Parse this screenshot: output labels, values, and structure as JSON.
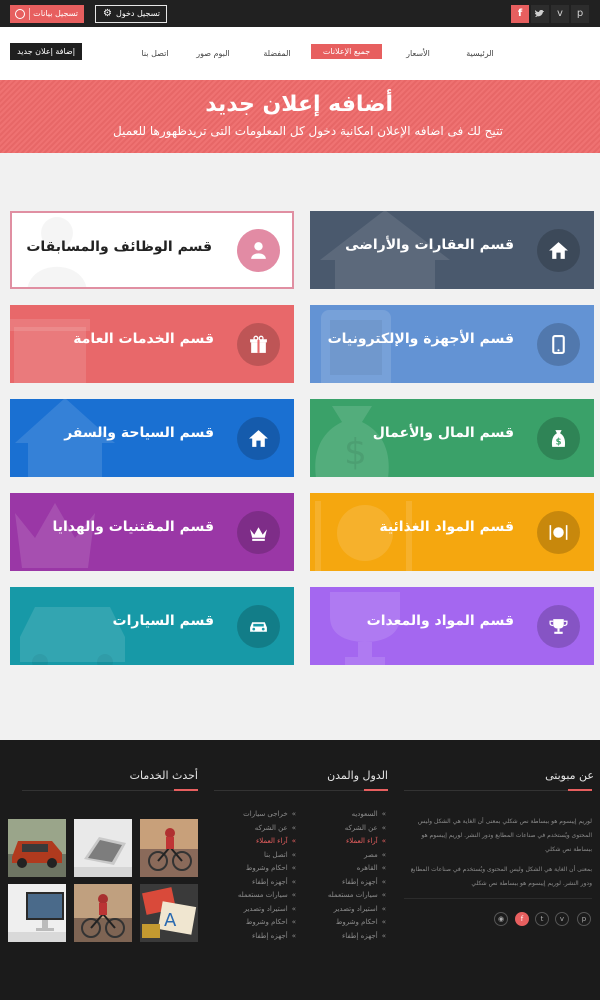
{
  "topbar": {
    "social": [
      "p",
      "v",
      "twitter",
      "f"
    ],
    "login_label": "تسجيل دخول",
    "register_label": "تسجيل بيانات"
  },
  "nav": {
    "items": [
      {
        "label": "الرئيسية",
        "active": false
      },
      {
        "label": "الأسعار",
        "active": false
      },
      {
        "label": "جميع الإعلانات",
        "active": true
      },
      {
        "label": "المفضلة",
        "active": false
      },
      {
        "label": "البوم صور",
        "active": false
      },
      {
        "label": "اتصل بنا",
        "active": false
      }
    ],
    "add_ad_label": "إضافة إعلان جديد"
  },
  "hero": {
    "title": "أضافه إعلان جديد",
    "subtitle": "تتيح لك فى اضافه الإعلان امكانية دخول كل المعلومات التى تريدظهورها للعميل"
  },
  "categories": [
    {
      "label": "قسم العقارات والأراضى",
      "icon": "home-icon",
      "color": "#4a596d"
    },
    {
      "label": "قسم الوظائف والمسابقات",
      "icon": "user-icon",
      "color": "#ffffff"
    },
    {
      "label": "قسم الأجهزة والإلكترونيات",
      "icon": "tablet-icon",
      "color": "#6393d4"
    },
    {
      "label": "قسم الخدمات العامة",
      "icon": "gift-icon",
      "color": "#e8686a"
    },
    {
      "label": "قسم المال والأعمال",
      "icon": "money-bag-icon",
      "color": "#3aa169"
    },
    {
      "label": "قسم السياحة والسفر",
      "icon": "home-icon",
      "color": "#1a70d2"
    },
    {
      "label": "قسم المواد الغذائية",
      "icon": "food-icon",
      "color": "#f5a70f"
    },
    {
      "label": "قسم المقتنيات والهدايا",
      "icon": "crown-icon",
      "color": "#9a37a6"
    },
    {
      "label": "قسم المواد والمعدات",
      "icon": "trophy-icon",
      "color": "#a467f0"
    },
    {
      "label": "قسم السيارات",
      "icon": "car-icon",
      "color": "#1799a7"
    }
  ],
  "footer": {
    "about_title": "عن مبوبتى",
    "about_text_1": "لوريم إيبسوم هو ببساطة نص شكلي بمعنى أن الغاية هي الشكل وليس المحتوى ويُستخدم في صناعات المطابع ودور النشر. لوريم إيبسوم هو ببساطة نص شكلي",
    "about_text_2": "بمعنى أن الغاية هي الشكل وليس المحتوى ويُستخدم في صناعات المطابع ودور النشر. لوريم إيبسوم هو ببساطة نص شكلي",
    "social": [
      "p",
      "v",
      "twitter",
      "f",
      "rss"
    ],
    "countries_title": "الدول والمدن",
    "countries_right": [
      {
        "label": "السعوديه",
        "active": false
      },
      {
        "label": "عن الشركه",
        "active": false
      },
      {
        "label": "آراء العملاء",
        "active": true
      },
      {
        "label": "مصر",
        "active": false
      },
      {
        "label": "القاهره",
        "active": false
      },
      {
        "label": "أجهزه إطفاء",
        "active": false
      },
      {
        "label": "سيارات مستعمله",
        "active": false
      },
      {
        "label": "استيراد وتصدير",
        "active": false
      },
      {
        "label": "احكام وشروط",
        "active": false
      },
      {
        "label": "أجهزه إطفاء",
        "active": false
      }
    ],
    "countries_left": [
      {
        "label": "خراجى سيارات",
        "active": false
      },
      {
        "label": "عن الشركه",
        "active": false
      },
      {
        "label": "آراء العملاء",
        "active": true
      },
      {
        "label": "اتصل بنا",
        "active": false
      },
      {
        "label": "احكام وشروط",
        "active": false
      },
      {
        "label": "أجهزه إطفاء",
        "active": false
      },
      {
        "label": "سيارات مستعمله",
        "active": false
      },
      {
        "label": "استيراد وتصدير",
        "active": false
      },
      {
        "label": "احكام وشروط",
        "active": false
      },
      {
        "label": "أجهزه إطفاء",
        "active": false
      }
    ],
    "services_title": "أحدث الخدمات",
    "thumbs": [
      "bicycle-photo",
      "laptop-photo",
      "car-photo",
      "design-photo",
      "bicycle-photo",
      "monitor-photo"
    ]
  }
}
